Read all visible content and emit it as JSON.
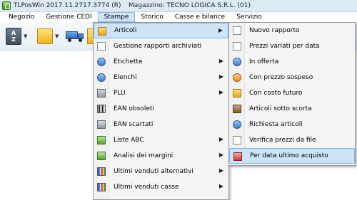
{
  "window": {
    "title": "TLPosWin 2017.11.2717.3774 (R)",
    "store_info": "Magazzino: TECNO LOGICA S.R.L. (01)"
  },
  "menubar": [
    {
      "label": "Negozio"
    },
    {
      "label": "Gestione CEDI"
    },
    {
      "label": "Stampe",
      "active": true
    },
    {
      "label": "Storico"
    },
    {
      "label": "Casse e bilance"
    },
    {
      "label": "Servizio"
    }
  ],
  "toolbar": {
    "az_icon_text_top": "A",
    "az_icon_text_bottom": "Z"
  },
  "stampe_menu": [
    {
      "label": "Articoli",
      "icon": "box-icon",
      "submenu": true,
      "highlighted": true
    },
    {
      "label": "Gestione rapporti archiviati",
      "icon": "archive-icon",
      "submenu": false
    },
    {
      "label": "Etichette",
      "icon": "label-icon",
      "submenu": true
    },
    {
      "label": "Elenchi",
      "icon": "list-icon",
      "submenu": true
    },
    {
      "label": "PLU",
      "icon": "plu-icon",
      "submenu": true
    },
    {
      "label": "EAN obsoleti",
      "icon": "barcode-icon",
      "submenu": false
    },
    {
      "label": "EAN scartati",
      "icon": "barcode-icon",
      "submenu": false
    },
    {
      "label": "Liste ABC",
      "icon": "abc-list-icon",
      "submenu": true
    },
    {
      "label": "Analisi dei margini",
      "icon": "margin-chart-icon",
      "submenu": true
    },
    {
      "label": "Ultimi venduti alternativi",
      "icon": "sales-icon",
      "submenu": true
    },
    {
      "label": "Ultimi venduti casse",
      "icon": "register-icon",
      "submenu": true
    }
  ],
  "articoli_submenu": [
    {
      "label": "Nuovo rapporto",
      "icon": "new-report-icon"
    },
    {
      "label": "Prezzi variati per data",
      "icon": "price-change-icon"
    },
    {
      "label": "In offerta",
      "icon": "offer-icon"
    },
    {
      "label": "Con prezzo sospeso",
      "icon": "suspended-price-icon"
    },
    {
      "label": "Con costo futuro",
      "icon": "future-cost-icon"
    },
    {
      "label": "Articoli sotto scorta",
      "icon": "low-stock-icon"
    },
    {
      "label": "Richiesta articoli",
      "icon": "request-icon"
    },
    {
      "label": "Verifica prezzi da file",
      "icon": "verify-file-icon"
    },
    {
      "label": "Per data ultimo acquisto",
      "icon": "last-purchase-icon",
      "highlighted": true
    }
  ]
}
